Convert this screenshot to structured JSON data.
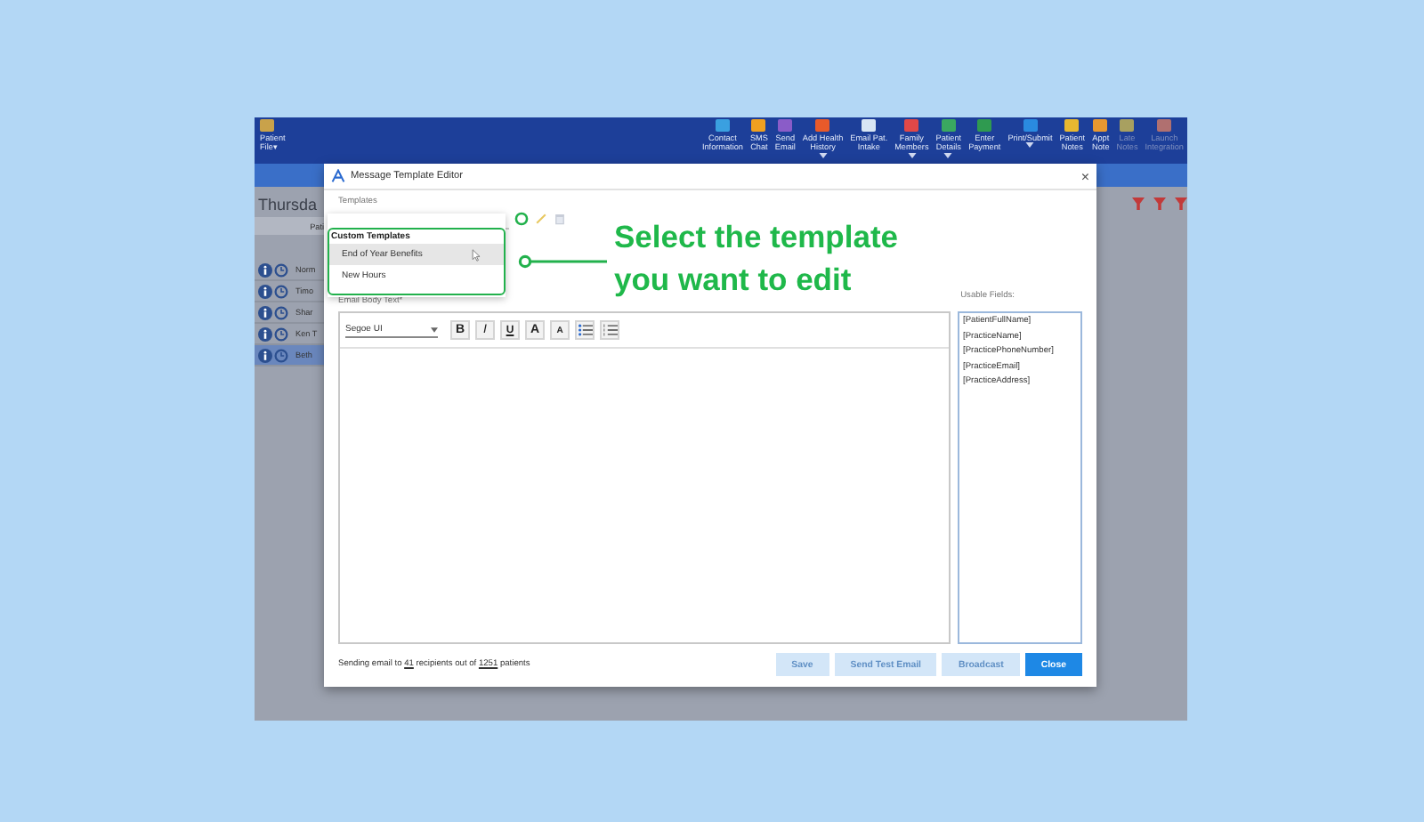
{
  "app_toolbar": {
    "left_item": {
      "label": "Patient\nFile▾",
      "color": "#c9a24a"
    },
    "items": [
      {
        "label": "Contact\nInformation",
        "color": "#3aa0e0",
        "disabled": false,
        "dropdown": false
      },
      {
        "label": "SMS\nChat",
        "color": "#f0a020",
        "disabled": false,
        "dropdown": false
      },
      {
        "label": "Send\nEmail",
        "color": "#8a5cc8",
        "disabled": false,
        "dropdown": false
      },
      {
        "label": "Add Health\nHistory",
        "color": "#e85a2a",
        "disabled": false,
        "dropdown": true
      },
      {
        "label": "Email Pat.\nIntake",
        "color": "#d8e6f4",
        "disabled": false,
        "dropdown": false
      },
      {
        "label": "Family\nMembers",
        "color": "#e04848",
        "disabled": false,
        "dropdown": true
      },
      {
        "label": "Patient\nDetails",
        "color": "#3aa860",
        "disabled": false,
        "dropdown": true
      },
      {
        "label": "Enter\nPayment",
        "color": "#2f9a50",
        "disabled": false,
        "dropdown": false
      },
      {
        "label": "Print/Submit",
        "color": "#2a8ae0",
        "disabled": false,
        "dropdown": true
      },
      {
        "label": "Patient\nNotes",
        "color": "#e8b830",
        "disabled": false,
        "dropdown": false
      },
      {
        "label": "Appt\nNote",
        "color": "#e89830",
        "disabled": false,
        "dropdown": false
      },
      {
        "label": "Late\nNotes",
        "color": "#a8a060",
        "disabled": true,
        "dropdown": false
      },
      {
        "label": "Launch\nIntegration",
        "color": "#b07070",
        "disabled": true,
        "dropdown": false
      }
    ]
  },
  "background_list": {
    "title": "Thursda",
    "column": "Pati",
    "rows": [
      {
        "name": "Norm",
        "selected": false
      },
      {
        "name": "Timo",
        "selected": false
      },
      {
        "name": "Shar",
        "selected": false
      },
      {
        "name": "Ken T",
        "selected": false
      },
      {
        "name": "Beth",
        "selected": true
      }
    ]
  },
  "dialog": {
    "title": "Message Template Editor",
    "close": "×",
    "templates_label": "Templates",
    "dropdown": {
      "group": "Custom Templates",
      "options": [
        {
          "label": "End of Year Benefits",
          "selected": true
        },
        {
          "label": "New Hours",
          "selected": false
        }
      ]
    },
    "body_label": "Email Body Text*",
    "font": "Segoe UI",
    "format_buttons": [
      {
        "label": "B",
        "kind": "bold"
      },
      {
        "label": "I",
        "kind": "italic"
      },
      {
        "label": "U",
        "kind": "underline"
      },
      {
        "label": "A",
        "kind": "grow"
      },
      {
        "label": "A",
        "kind": "shrink"
      },
      {
        "kind": "bullets"
      },
      {
        "kind": "numbers"
      }
    ],
    "fields_label": "Usable Fields:",
    "fields": [
      "[PatientFullName]",
      "[PracticeName]",
      "[PracticePhoneNumber]",
      "[PracticeEmail]",
      "[PracticeAddress]"
    ],
    "status": [
      {
        "text": "Sending email to ",
        "underlined": false
      },
      {
        "text": "41",
        "underlined": true
      },
      {
        "text": " recipients out of ",
        "underlined": false
      },
      {
        "text": "1251",
        "underlined": true
      },
      {
        "text": " patients",
        "underlined": false
      }
    ],
    "buttons": [
      {
        "label": "Save",
        "disabled": true,
        "primary": false
      },
      {
        "label": "Send Test Email",
        "disabled": true,
        "primary": false
      },
      {
        "label": "Broadcast",
        "disabled": true,
        "primary": false
      },
      {
        "label": "Close",
        "disabled": false,
        "primary": true
      }
    ]
  },
  "callout": {
    "text": "Select the template\nyou want to edit"
  }
}
